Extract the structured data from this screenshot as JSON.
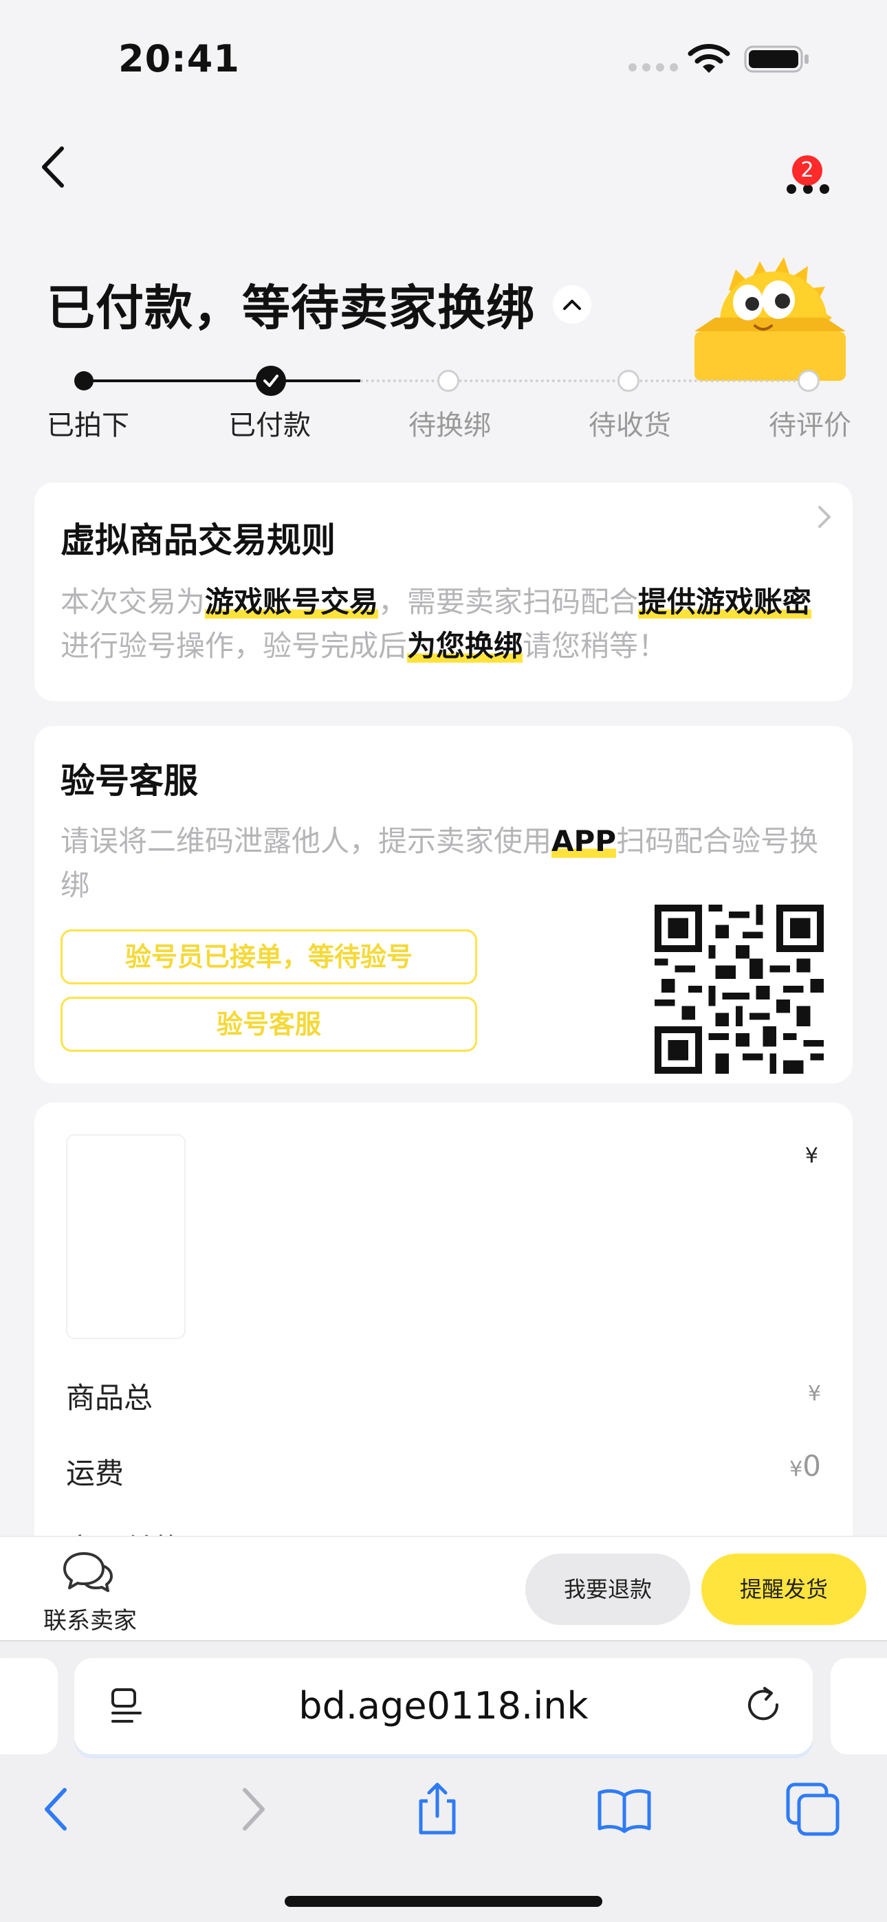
{
  "status_bar": {
    "time": "20:41"
  },
  "header": {
    "badge_count": "2"
  },
  "page": {
    "title": "已付款，等待卖家换绑"
  },
  "steps": [
    {
      "label": "已拍下",
      "state": "done"
    },
    {
      "label": "已付款",
      "state": "current"
    },
    {
      "label": "待换绑",
      "state": "pending"
    },
    {
      "label": "待收货",
      "state": "pending"
    },
    {
      "label": "待评价",
      "state": "pending"
    }
  ],
  "rules_card": {
    "title": "虚拟商品交易规则",
    "t1": "本次交易为",
    "h1": "游戏账号交易",
    "t2": "，需要卖家扫码配合",
    "h2": "提供游戏账密",
    "t3": "进行验号操作，验号完成后",
    "h3": "为您换绑",
    "t4": "请您稍等！"
  },
  "service_card": {
    "title": "验号客服",
    "t1": "请误将二维码泄露他人，提示卖家使用",
    "h1": "APP",
    "t2": "扫码配合验号换绑",
    "status_button": "验号员已接单，等待验号",
    "service_button": "验号客服"
  },
  "order_card": {
    "price_symbol": "¥",
    "rows": [
      {
        "label": "商品总",
        "value": "¥"
      },
      {
        "label": "运费",
        "currency": "¥",
        "amount": "0"
      },
      {
        "label": "实际付款"
      }
    ]
  },
  "action_bar": {
    "contact_label": "联系卖家",
    "refund_label": "我要退款",
    "remind_label": "提醒发货"
  },
  "browser": {
    "url": "bd.age0118.ink"
  },
  "colors": {
    "accent_yellow": "#ffe43d",
    "badge_red": "#ff2a2a",
    "link_blue": "#2f7bf5"
  }
}
